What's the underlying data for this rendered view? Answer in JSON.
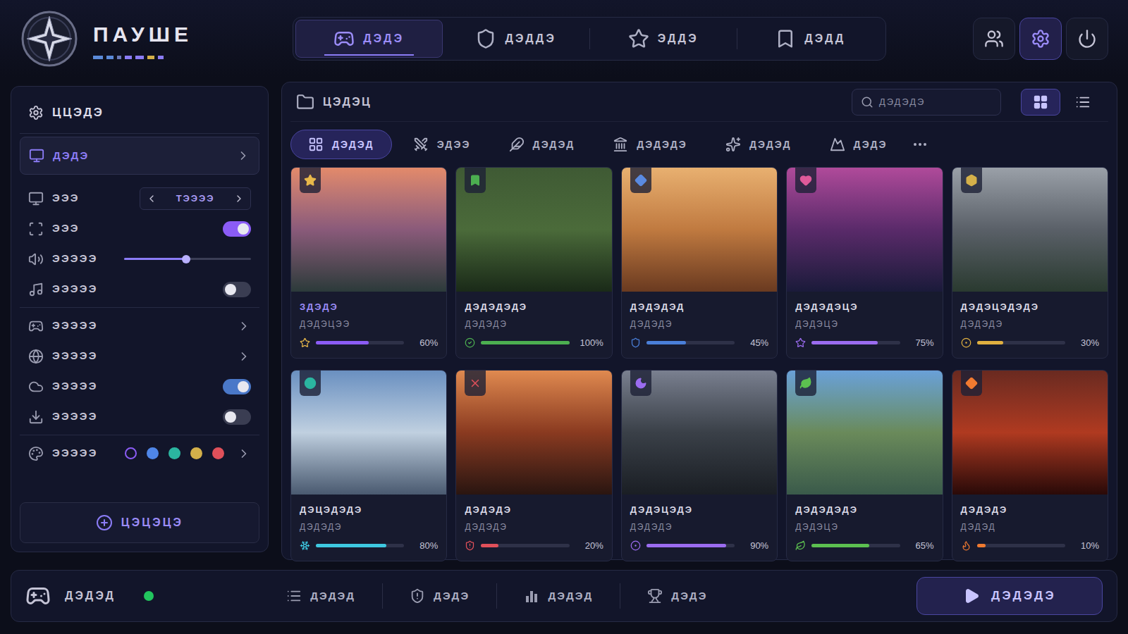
{
  "app": {
    "title": "ПАУШЕ"
  },
  "nav_tabs": [
    {
      "label": "ДЭДЭ",
      "selected": true
    },
    {
      "label": "ДЭДДЭ",
      "selected": false
    },
    {
      "label": "ЭДДЭ",
      "selected": false
    },
    {
      "label": "ДЭДД",
      "selected": false
    }
  ],
  "header_buttons": [
    {
      "selected": false
    },
    {
      "selected": true
    },
    {
      "selected": false
    }
  ],
  "settings": {
    "title": "ЦЦЭДЭ",
    "groups": [
      [
        {
          "kind": "nav",
          "label": "ДЭДЭ",
          "selected": true
        },
        {
          "kind": "select",
          "label": "ЭЭЭ",
          "value": "ТЭЭЭЭ"
        },
        {
          "kind": "toggle",
          "label": "ЭЭЭ",
          "on": true,
          "color": "#8b5cf6"
        },
        {
          "kind": "slider",
          "label": "ЭЭЭЭЭ",
          "level": 0.49
        },
        {
          "kind": "toggle",
          "label": "ЭЭЭЭЭ",
          "on": false,
          "color": "#8b5cf6"
        }
      ],
      [
        {
          "kind": "nav",
          "label": "ЭЭЭЭЭ",
          "selected": false
        },
        {
          "kind": "nav",
          "label": "ЭЭЭЭЭ",
          "selected": false
        },
        {
          "kind": "toggle",
          "label": "ЭЭЭЭЭ",
          "on": true,
          "color": "#4a78c8"
        },
        {
          "kind": "toggle",
          "label": "ЭЭЭЭЭ",
          "on": false,
          "color": "#8b5cf6"
        }
      ],
      [
        {
          "kind": "swatches",
          "label": "ЭЭЭЭЭ",
          "swatches": [
            {
              "color": "#8b5cf6",
              "selected": true
            },
            {
              "color": "#4f86e8",
              "selected": false
            },
            {
              "color": "#2bb5a0",
              "selected": false
            },
            {
              "color": "#d4b04a",
              "selected": false
            },
            {
              "color": "#e0505a",
              "selected": false
            }
          ]
        }
      ]
    ],
    "button": "ЦЭЦЭЦЭ"
  },
  "library": {
    "title": "ЦЭДЭЦ",
    "search_placeholder": "ДЭДЭДЭ",
    "views": [
      {
        "selected": true
      },
      {
        "selected": false
      }
    ],
    "filters": [
      {
        "label": "ДЭДЭД",
        "selected": true
      },
      {
        "label": "ЭДЭЭ",
        "selected": false
      },
      {
        "label": "ДЭДЭД",
        "selected": false
      },
      {
        "label": "ДЭДЭДЭ",
        "selected": false
      },
      {
        "label": "ДЭДЭД",
        "selected": false
      },
      {
        "label": "ДЭДЭ",
        "selected": false
      }
    ]
  },
  "cards": [
    {
      "title": "ЗДЭДЭ",
      "subtitle": "ДЭДЭЦЭЭ",
      "percent": "60%",
      "level": 0.6,
      "color": "#8b5cf6",
      "badge_color": "#e8b84a",
      "selected": true
    },
    {
      "title": "ДЭДЭДЭДЭ",
      "subtitle": "ДЭДЭДЭ",
      "percent": "100%",
      "level": 1.0,
      "color": "#4caf50",
      "badge_color": "#4caf50",
      "selected": false
    },
    {
      "title": "ДЭДЭДЭД",
      "subtitle": "ДЭДЭДЭ",
      "percent": "45%",
      "level": 0.45,
      "color": "#4a7fd8",
      "badge_color": "#5a8ae0",
      "selected": false
    },
    {
      "title": "ДЭДЭДЭЦЭ",
      "subtitle": "ДЭДЭЦЭ",
      "percent": "75%",
      "level": 0.75,
      "color": "#9b6cf0",
      "badge_color": "#e05a9a",
      "selected": false
    },
    {
      "title": "ДЭДЭЦЭДЭДЭ",
      "subtitle": "ДЭДЭДЭ",
      "percent": "30%",
      "level": 0.3,
      "color": "#e0b040",
      "badge_color": "#d4b04a",
      "selected": false
    },
    {
      "title": "ДЭЦЭДЭДЭ",
      "subtitle": "ДЭДЭДЭ",
      "percent": "80%",
      "level": 0.8,
      "color": "#3ec8e0",
      "badge_color": "#2bb5a0",
      "selected": false
    },
    {
      "title": "ДЭДЭДЭ",
      "subtitle": "ДЭДЭДЭ",
      "percent": "20%",
      "level": 0.2,
      "color": "#e0505a",
      "badge_color": "#e0505a",
      "selected": false
    },
    {
      "title": "ДЭДЭЦЭДЭ",
      "subtitle": "ДЭДЭДЭ",
      "percent": "90%",
      "level": 0.9,
      "color": "#9b6cf0",
      "badge_color": "#9b6cf0",
      "selected": false
    },
    {
      "title": "ДЭДЭДЭДЭ",
      "subtitle": "ДЭДЭЦЭ",
      "percent": "65%",
      "level": 0.65,
      "color": "#5cc050",
      "badge_color": "#5cc050",
      "selected": false
    },
    {
      "title": "ДЭДЭДЭ",
      "subtitle": "ДЭДЭД",
      "percent": "10%",
      "level": 0.1,
      "color": "#f07a30",
      "badge_color": "#f07a30",
      "selected": false
    }
  ],
  "status_bar": {
    "label": "ДЭДЭД",
    "online": true,
    "dot_color": "#22c55e",
    "tabs": [
      {
        "label": "ДЭДЭД"
      },
      {
        "label": "ДЭДЭ"
      },
      {
        "label": "ДЭДЭД"
      },
      {
        "label": "ДЭДЭ"
      }
    ],
    "play": "ДЭДЭДЭ"
  }
}
